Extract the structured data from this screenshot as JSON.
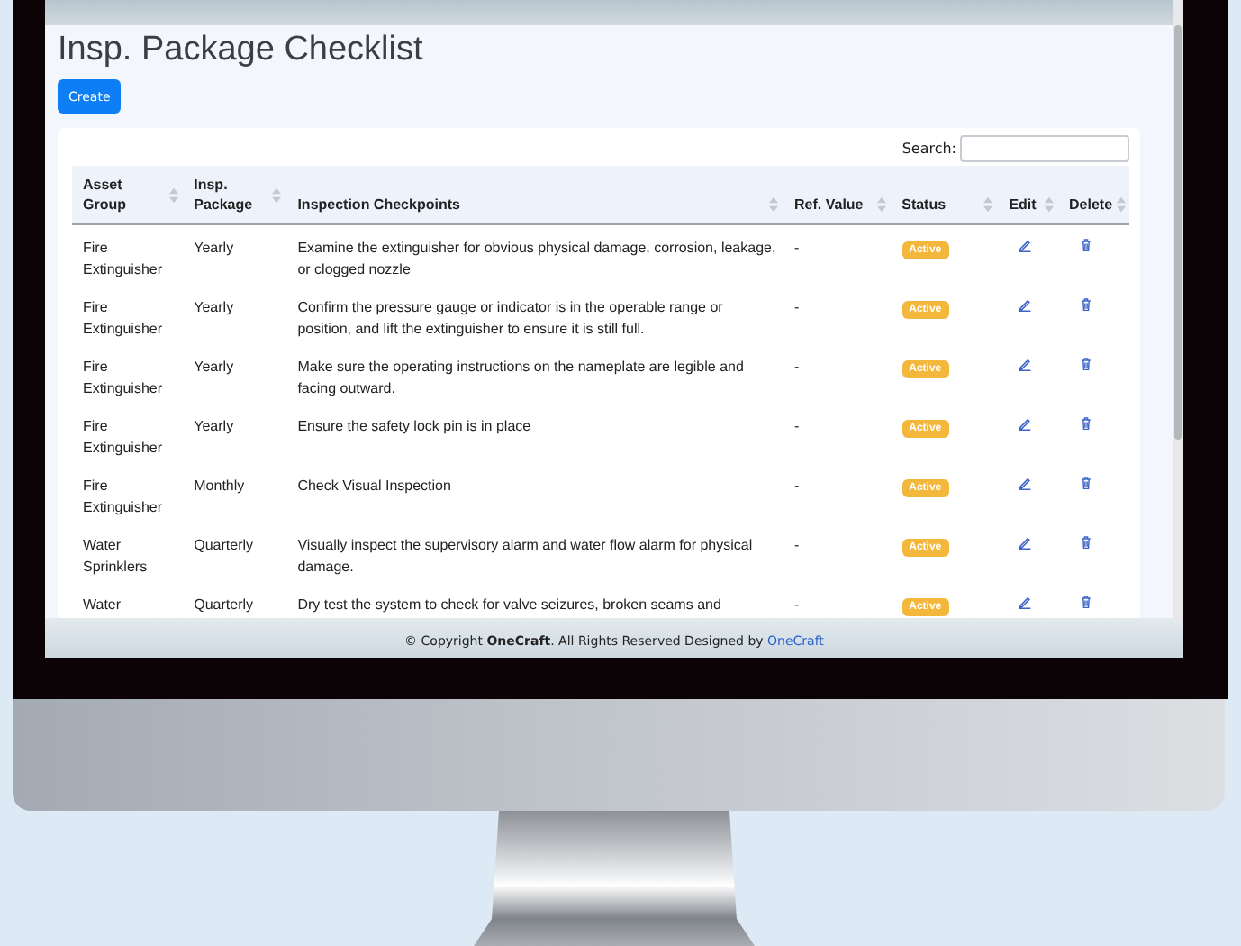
{
  "page": {
    "title": "Insp. Package Checklist",
    "create_button": "Create"
  },
  "search": {
    "label": "Search:"
  },
  "table": {
    "columns": [
      {
        "label": "Asset Group"
      },
      {
        "label": "Insp. Package"
      },
      {
        "label": "Inspection Checkpoints"
      },
      {
        "label": "Ref. Value"
      },
      {
        "label": "Status"
      },
      {
        "label": "Edit"
      },
      {
        "label": "Delete"
      }
    ],
    "rows": [
      {
        "asset_group": "Fire Extinguisher",
        "package": "Yearly",
        "checkpoint": "Examine the extinguisher for obvious physical damage, corrosion, leakage, or clogged nozzle",
        "ref_value": "-",
        "status": "Active"
      },
      {
        "asset_group": "Fire Extinguisher",
        "package": "Yearly",
        "checkpoint": "Confirm the pressure gauge or indicator is in the operable range or position, and lift the extinguisher to ensure it is still full.",
        "ref_value": "-",
        "status": "Active"
      },
      {
        "asset_group": "Fire Extinguisher",
        "package": "Yearly",
        "checkpoint": "Make sure the operating instructions on the nameplate are legible and facing outward.",
        "ref_value": "-",
        "status": "Active"
      },
      {
        "asset_group": "Fire Extinguisher",
        "package": "Yearly",
        "checkpoint": "Ensure the safety lock pin is in place",
        "ref_value": "-",
        "status": "Active"
      },
      {
        "asset_group": "Fire Extinguisher",
        "package": "Monthly",
        "checkpoint": "Check Visual Inspection",
        "ref_value": "-",
        "status": "Active"
      },
      {
        "asset_group": "Water Sprinklers",
        "package": "Quarterly",
        "checkpoint": "Visually inspect the supervisory alarm and water flow alarm for physical damage.",
        "ref_value": "-",
        "status": "Active"
      },
      {
        "asset_group": "Water",
        "package": "Quarterly",
        "checkpoint": "Dry test the system to check for valve seizures, broken seams and",
        "ref_value": "-",
        "status": "Active"
      }
    ]
  },
  "footer": {
    "text": "© Copyright **OneCraft**. All Rights Reserved Designed by",
    "link": "OneCraft"
  }
}
